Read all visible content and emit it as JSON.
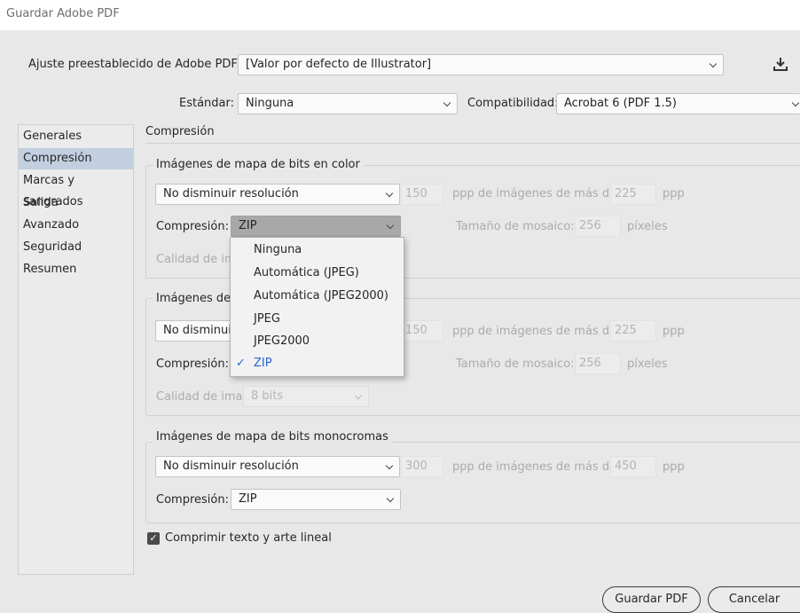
{
  "window": {
    "title": "Guardar Adobe PDF"
  },
  "preset": {
    "label": "Ajuste preestablecido de Adobe PDF:",
    "value": "[Valor por defecto de Illustrator]",
    "icon": "download-icon"
  },
  "standard": {
    "label": "Estándar:",
    "value": "Ninguna"
  },
  "compatibility": {
    "label": "Compatibilidad:",
    "value": "Acrobat 6 (PDF 1.5)"
  },
  "sidebar": {
    "items": [
      {
        "label": "Generales"
      },
      {
        "label": "Compresión",
        "selected": true
      },
      {
        "label": "Marcas y sangrados"
      },
      {
        "label": "Salida"
      },
      {
        "label": "Avanzado"
      },
      {
        "label": "Seguridad"
      },
      {
        "label": "Resumen"
      }
    ]
  },
  "section_title": "Compresión",
  "color_images": {
    "title": "Imágenes de mapa de bits en color",
    "downsample": "No disminuir resolución",
    "ppi": "150",
    "above_text": "ppp de imágenes de más de",
    "above_ppi": "225",
    "ppp": "ppp",
    "compression_label": "Compresión:",
    "compression_value": "ZIP",
    "tile_label": "Tamaño de mosaico:",
    "tile_value": "256",
    "tile_unit": "píxeles",
    "quality_label": "Calidad de im"
  },
  "gray_images": {
    "title": "Imágenes de",
    "downsample": "No disminui",
    "ppi": "150",
    "above_text": "ppp de imágenes de más de",
    "above_ppi": "225",
    "ppp": "ppp",
    "compression_label": "Compresión:",
    "tile_label": "Tamaño de mosaico:",
    "tile_value": "256",
    "tile_unit": "píxeles",
    "quality_label": "Calidad de imagen:",
    "quality_value": "8 bits"
  },
  "mono_images": {
    "title": "Imágenes de mapa de bits monocromas",
    "downsample": "No disminuir resolución",
    "ppi": "300",
    "above_text": "ppp de imágenes de más de",
    "above_ppi": "450",
    "ppp": "ppp",
    "compression_label": "Compresión:",
    "compression_value": "ZIP"
  },
  "compress_text": {
    "label": "Comprimir texto y arte lineal",
    "checked": true
  },
  "dropdown": {
    "options": [
      "Ninguna",
      "Automática (JPEG)",
      "Automática (JPEG2000)",
      "JPEG",
      "JPEG2000",
      "ZIP"
    ],
    "selected": "ZIP",
    "accent": "#2864d2"
  },
  "buttons": {
    "save": "Guardar PDF",
    "cancel": "Cancelar"
  }
}
